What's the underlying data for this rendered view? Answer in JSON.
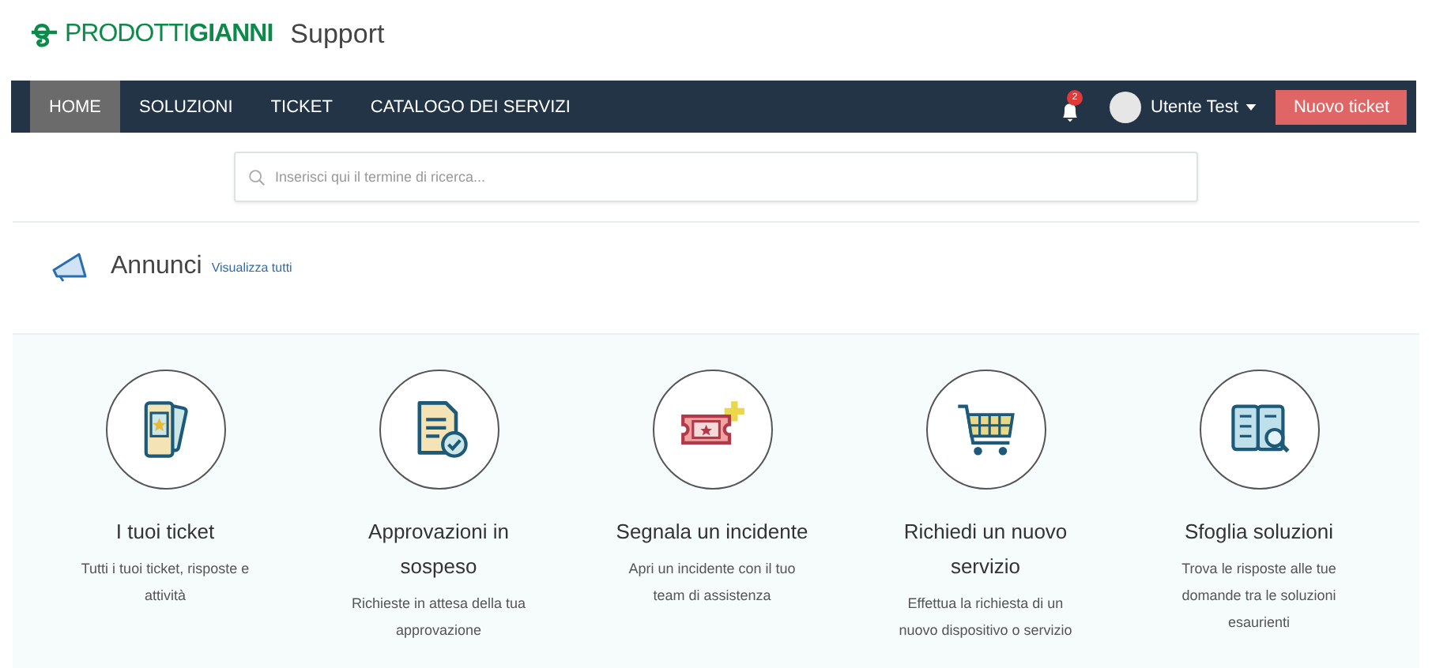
{
  "header": {
    "logo": "PRODOTTI**GIANNI**",
    "title": "Support"
  },
  "nav": {
    "tabs": [
      {
        "label": "HOME",
        "selected": true
      },
      {
        "label": "SOLUZIONI",
        "selected": false
      },
      {
        "label": "TICKET",
        "selected": false
      },
      {
        "label": "CATALOGO DEI SERVIZI",
        "selected": false
      }
    ],
    "notifications": "2",
    "user": "Utente Test",
    "new_ticket": "Nuovo ticket"
  },
  "search": {
    "placeholder": "Inserisci qui il termine di ricerca..."
  },
  "announcements": {
    "title": "Annunci",
    "link": "Visualizza tutti"
  },
  "tiles": [
    {
      "kind": "tickets",
      "title": "I tuoi ticket",
      "description": "Tutti i tuoi ticket, risposte e attività"
    },
    {
      "kind": "approval",
      "title": "Approvazioni in sospeso",
      "description": "Richieste in attesa della tua approvazione"
    },
    {
      "kind": "incident",
      "title": "Segnala un incidente",
      "description": "Apri un incidente con il tuo team di assistenza"
    },
    {
      "kind": "cart",
      "title": "Richiedi un nuovo servizio",
      "description": "Effettua la richiesta di un nuovo dispositivo o servizio"
    },
    {
      "kind": "book",
      "title": "Sfoglia soluzioni",
      "description": "Trova le risposte alle tue domande tra le soluzioni esaurienti"
    }
  ]
}
